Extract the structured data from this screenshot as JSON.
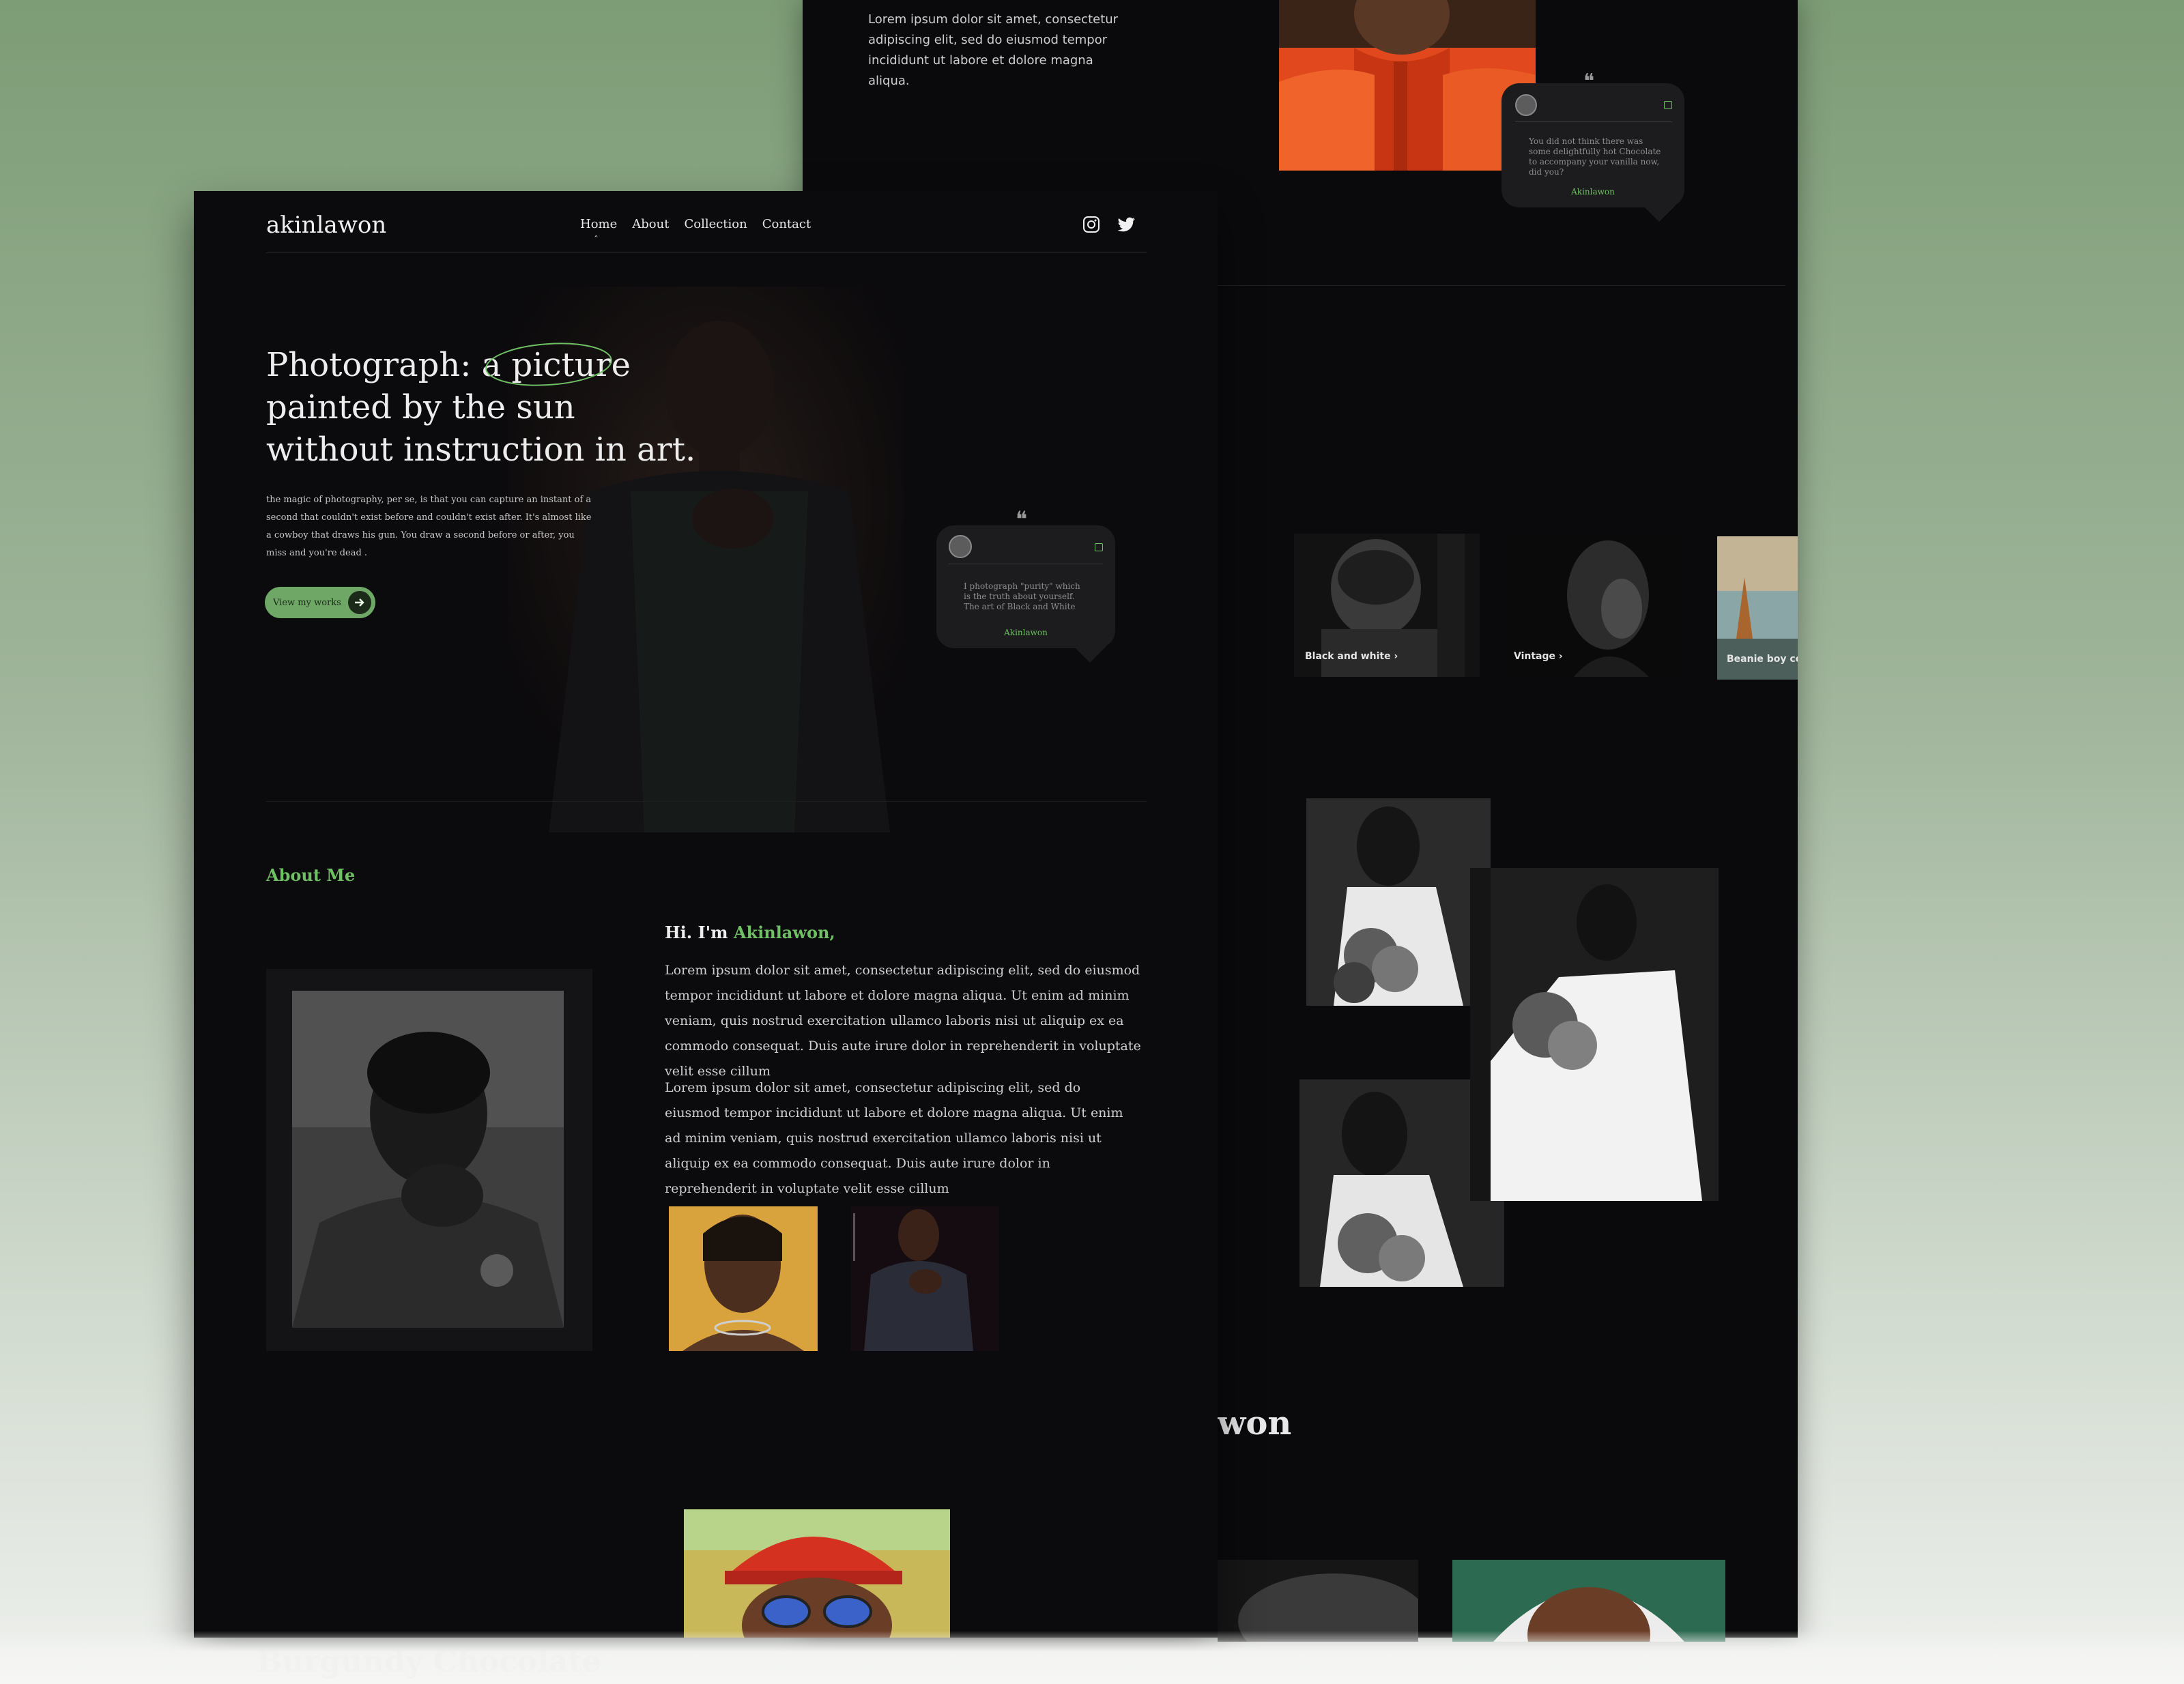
{
  "brand": "akinlawon",
  "nav": {
    "items": [
      "Home",
      "About",
      "Collection",
      "Contact"
    ],
    "active": "Home"
  },
  "social": {
    "instagram": "instagram-icon",
    "twitter": "twitter-icon"
  },
  "hero": {
    "headline_l1_pre": "Photograph: a ",
    "headline_l1_hl": "picture",
    "headline_l2": "painted by the sun",
    "headline_l3": "without instruction in art.",
    "paragraph": "the magic of photography, per se, is that you can capture an instant of a second that couldn't exist before and couldn't exist after. It's almost like a cowboy that draws his gun. You draw a second before or after, you miss and you're dead .",
    "cta_label": "View my works"
  },
  "quote_front": {
    "text": "I photograph \"purity\" which is the truth about yourself. The art of Black and White",
    "author": "Akinlawon"
  },
  "about": {
    "section_label": "About Me",
    "greeting_pre": "Hi. I'm ",
    "greeting_name": "Akinlawon,",
    "para1": "Lorem ipsum dolor sit amet, consectetur adipiscing elit, sed do eiusmod tempor incididunt ut labore et dolore magna aliqua. Ut enim ad minim veniam, quis nostrud exercitation ullamco laboris nisi ut aliquip ex ea commodo consequat. Duis aute irure dolor in reprehenderit in voluptate velit esse cillum",
    "para2": "Lorem ipsum dolor sit amet, consectetur adipiscing elit, sed do eiusmod tempor incididunt ut labore et dolore magna aliqua. Ut enim ad minim veniam, quis nostrud exercitation ullamco laboris nisi ut aliquip ex ea commodo consequat. Duis aute irure dolor in reprehenderit in voluptate velit esse cillum"
  },
  "bottom_title_faded": "Burgundy Chocolate",
  "back": {
    "top_text": "Lorem ipsum dolor sit amet, consectetur adipiscing elit, sed do eiusmod tempor incididunt ut labore et dolore magna aliqua.",
    "quote_text": "You did not think there was some delightfully hot Chocolate to accompany your vanilla now, did you?",
    "quote_author": "Akinlawon",
    "collections": [
      "Black and white ›",
      "Vintage ›",
      "Beanie boy colle"
    ],
    "name_fragment": "won"
  },
  "colors": {
    "accent_green": "#6fbf64",
    "bg": "#0b0a0c",
    "card": "#1c1c1e"
  }
}
